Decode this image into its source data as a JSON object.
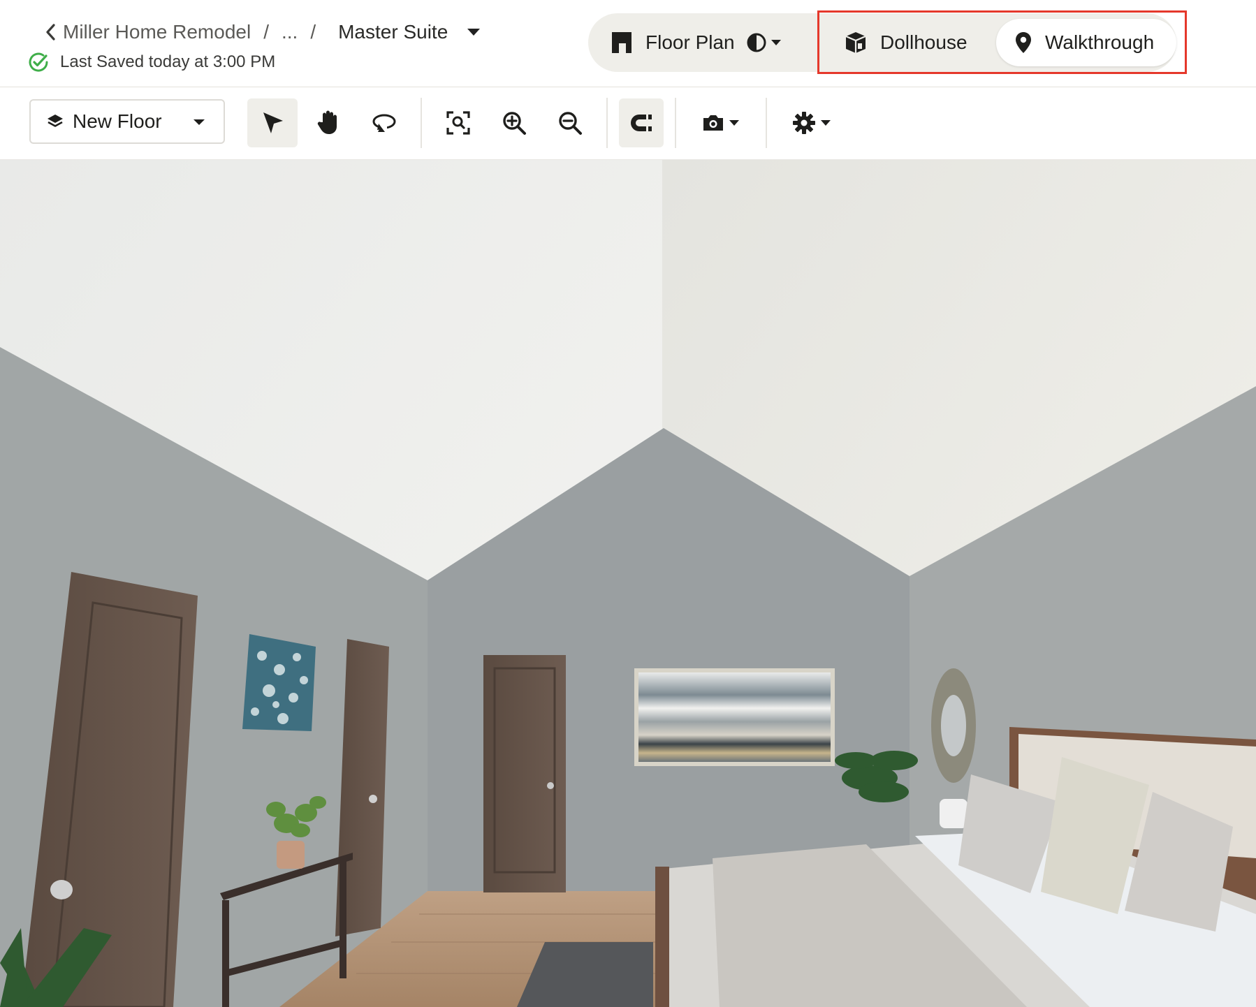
{
  "header": {
    "breadcrumb": {
      "project": "Miller Home Remodel",
      "separator": "/",
      "ellipsis": "...",
      "current": "Master Suite"
    },
    "saved_status": "Last Saved today at 3:00 PM"
  },
  "view_switch": {
    "floor_plan": "Floor Plan",
    "dollhouse": "Dollhouse",
    "walkthrough": "Walkthrough",
    "selected": "Walkthrough"
  },
  "toolbar": {
    "floor_select": "New Floor",
    "tools": [
      {
        "name": "select",
        "icon": "cursor-arrow-icon",
        "active": true
      },
      {
        "name": "pan",
        "icon": "hand-icon"
      },
      {
        "name": "rotate",
        "icon": "rotate-icon"
      },
      {
        "name": "zoom-fit",
        "icon": "zoom-fit-icon"
      },
      {
        "name": "zoom-in",
        "icon": "zoom-in-icon"
      },
      {
        "name": "zoom-out",
        "icon": "zoom-out-icon"
      },
      {
        "name": "snap",
        "icon": "magnet-icon",
        "active": true
      },
      {
        "name": "camera",
        "icon": "camera-icon"
      },
      {
        "name": "settings",
        "icon": "gear-icon"
      }
    ]
  },
  "colors": {
    "accent_highlight": "#e5382b",
    "saved_green": "#3fae49",
    "pill_bg": "#efeee9"
  }
}
